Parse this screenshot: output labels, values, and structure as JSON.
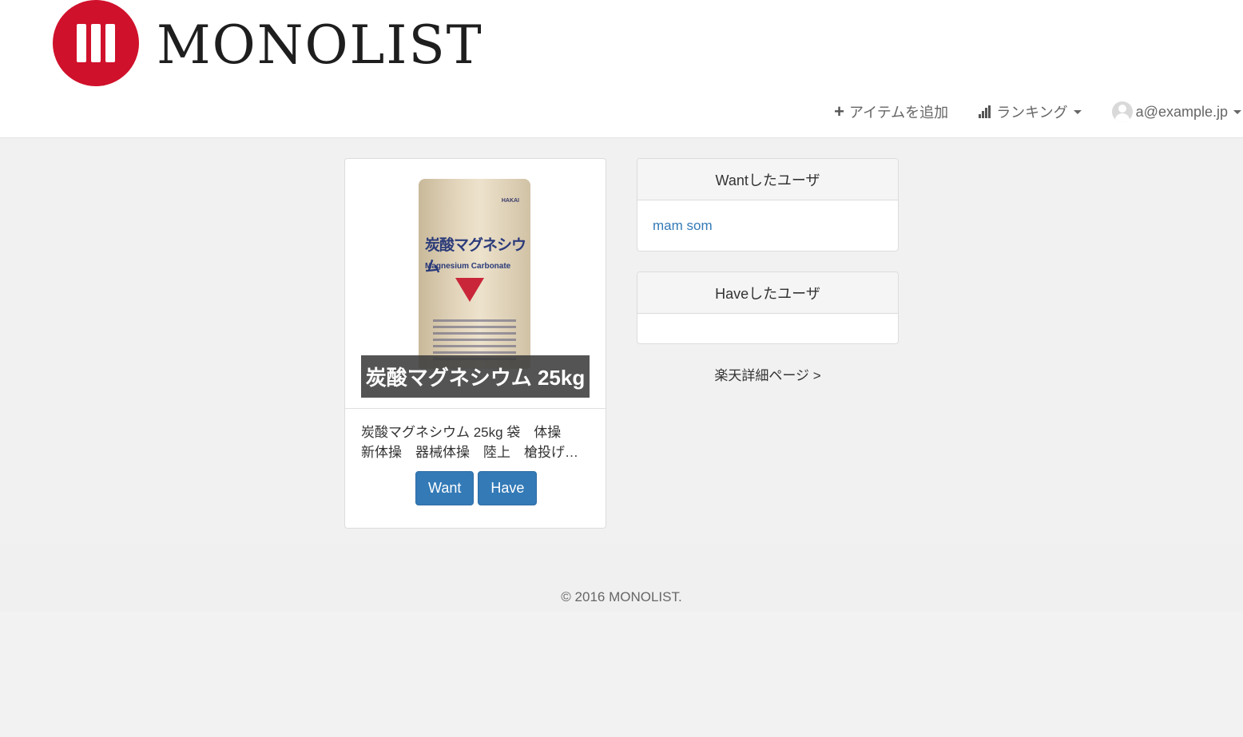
{
  "brand": {
    "name": "MONOLIST"
  },
  "nav": {
    "add_item": "アイテムを追加",
    "ranking": "ランキング",
    "user_email": "a@example.jp"
  },
  "item": {
    "image_caption": "炭酸マグネシウム 25kg",
    "bag_label": "炭酸マグネシウム",
    "bag_sub_label": "Magnesium Carbonate",
    "bag_brand": "HAKAI",
    "title": "炭酸マグネシウム 25kg 袋　体操\n新体操　器械体操　陸上　槍投げ…",
    "want_label": "Want",
    "have_label": "Have"
  },
  "want_users": {
    "heading": "Wantしたユーザ",
    "users": [
      "mam som"
    ]
  },
  "have_users": {
    "heading": "Haveしたユーザ",
    "users": []
  },
  "rakuten_link": "楽天詳細ページ >",
  "footer": {
    "copyright": "© 2016 MONOLIST."
  },
  "colors": {
    "brand_red": "#d0112b",
    "primary_blue": "#337ab7"
  }
}
